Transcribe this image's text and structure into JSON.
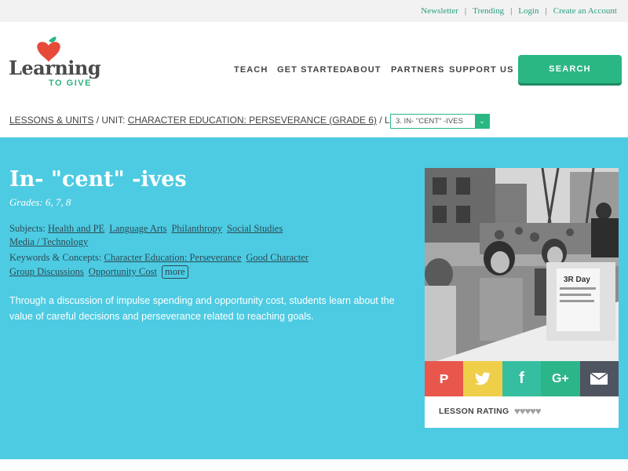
{
  "utility_links": [
    "Newsletter",
    "Trending",
    "Login",
    "Create an Account"
  ],
  "logo": {
    "word": "Learning",
    "sub": "TO GIVE"
  },
  "nav": [
    "TEACH",
    "GET STARTED",
    "ABOUT",
    "PARTNERS",
    "SUPPORT US"
  ],
  "search_label": "SEARCH",
  "breadcrumb": {
    "lessons": "LESSONS & UNITS",
    "sep1": " / UNIT: ",
    "unit": "CHARACTER EDUCATION: PERSEVERANCE (GRADE 6)",
    "sep2": " / LESSON: ",
    "lesson_select": "3. IN- \"CENT\" -IVES"
  },
  "lesson": {
    "title": "In- \"cent\" -ives",
    "grades": "Grades: 6, 7, 8",
    "subjects_label": "Subjects:",
    "subjects": [
      "Health and PE",
      "Language Arts",
      "Philanthropy",
      "Social Studies",
      "Media / Technology"
    ],
    "keywords_label": "Keywords & Concepts:",
    "keywords": [
      "Character Education: Perseverance",
      "Good Character",
      "Group Discussions",
      "Opportunity Cost"
    ],
    "more_label": "more",
    "description": "Through a discussion of impulse spending and opportunity cost, students learn about the value of careful decisions and perseverance related to reaching goals."
  },
  "card": {
    "photo_sign": "3R Day",
    "rating_label": "LESSON RATING",
    "hearts": "♥♥♥♥♥"
  },
  "share_icons": [
    "pinterest-icon",
    "twitter-icon",
    "facebook-icon",
    "google-plus-icon",
    "email-icon"
  ],
  "colors": {
    "brand_green": "#2ab784",
    "hero_blue": "#4dcbe2",
    "pinterest": "#e9574c",
    "twitter": "#efcf4a",
    "facebook": "#35bfa0",
    "google": "#2db58a",
    "email": "#4e5560"
  }
}
